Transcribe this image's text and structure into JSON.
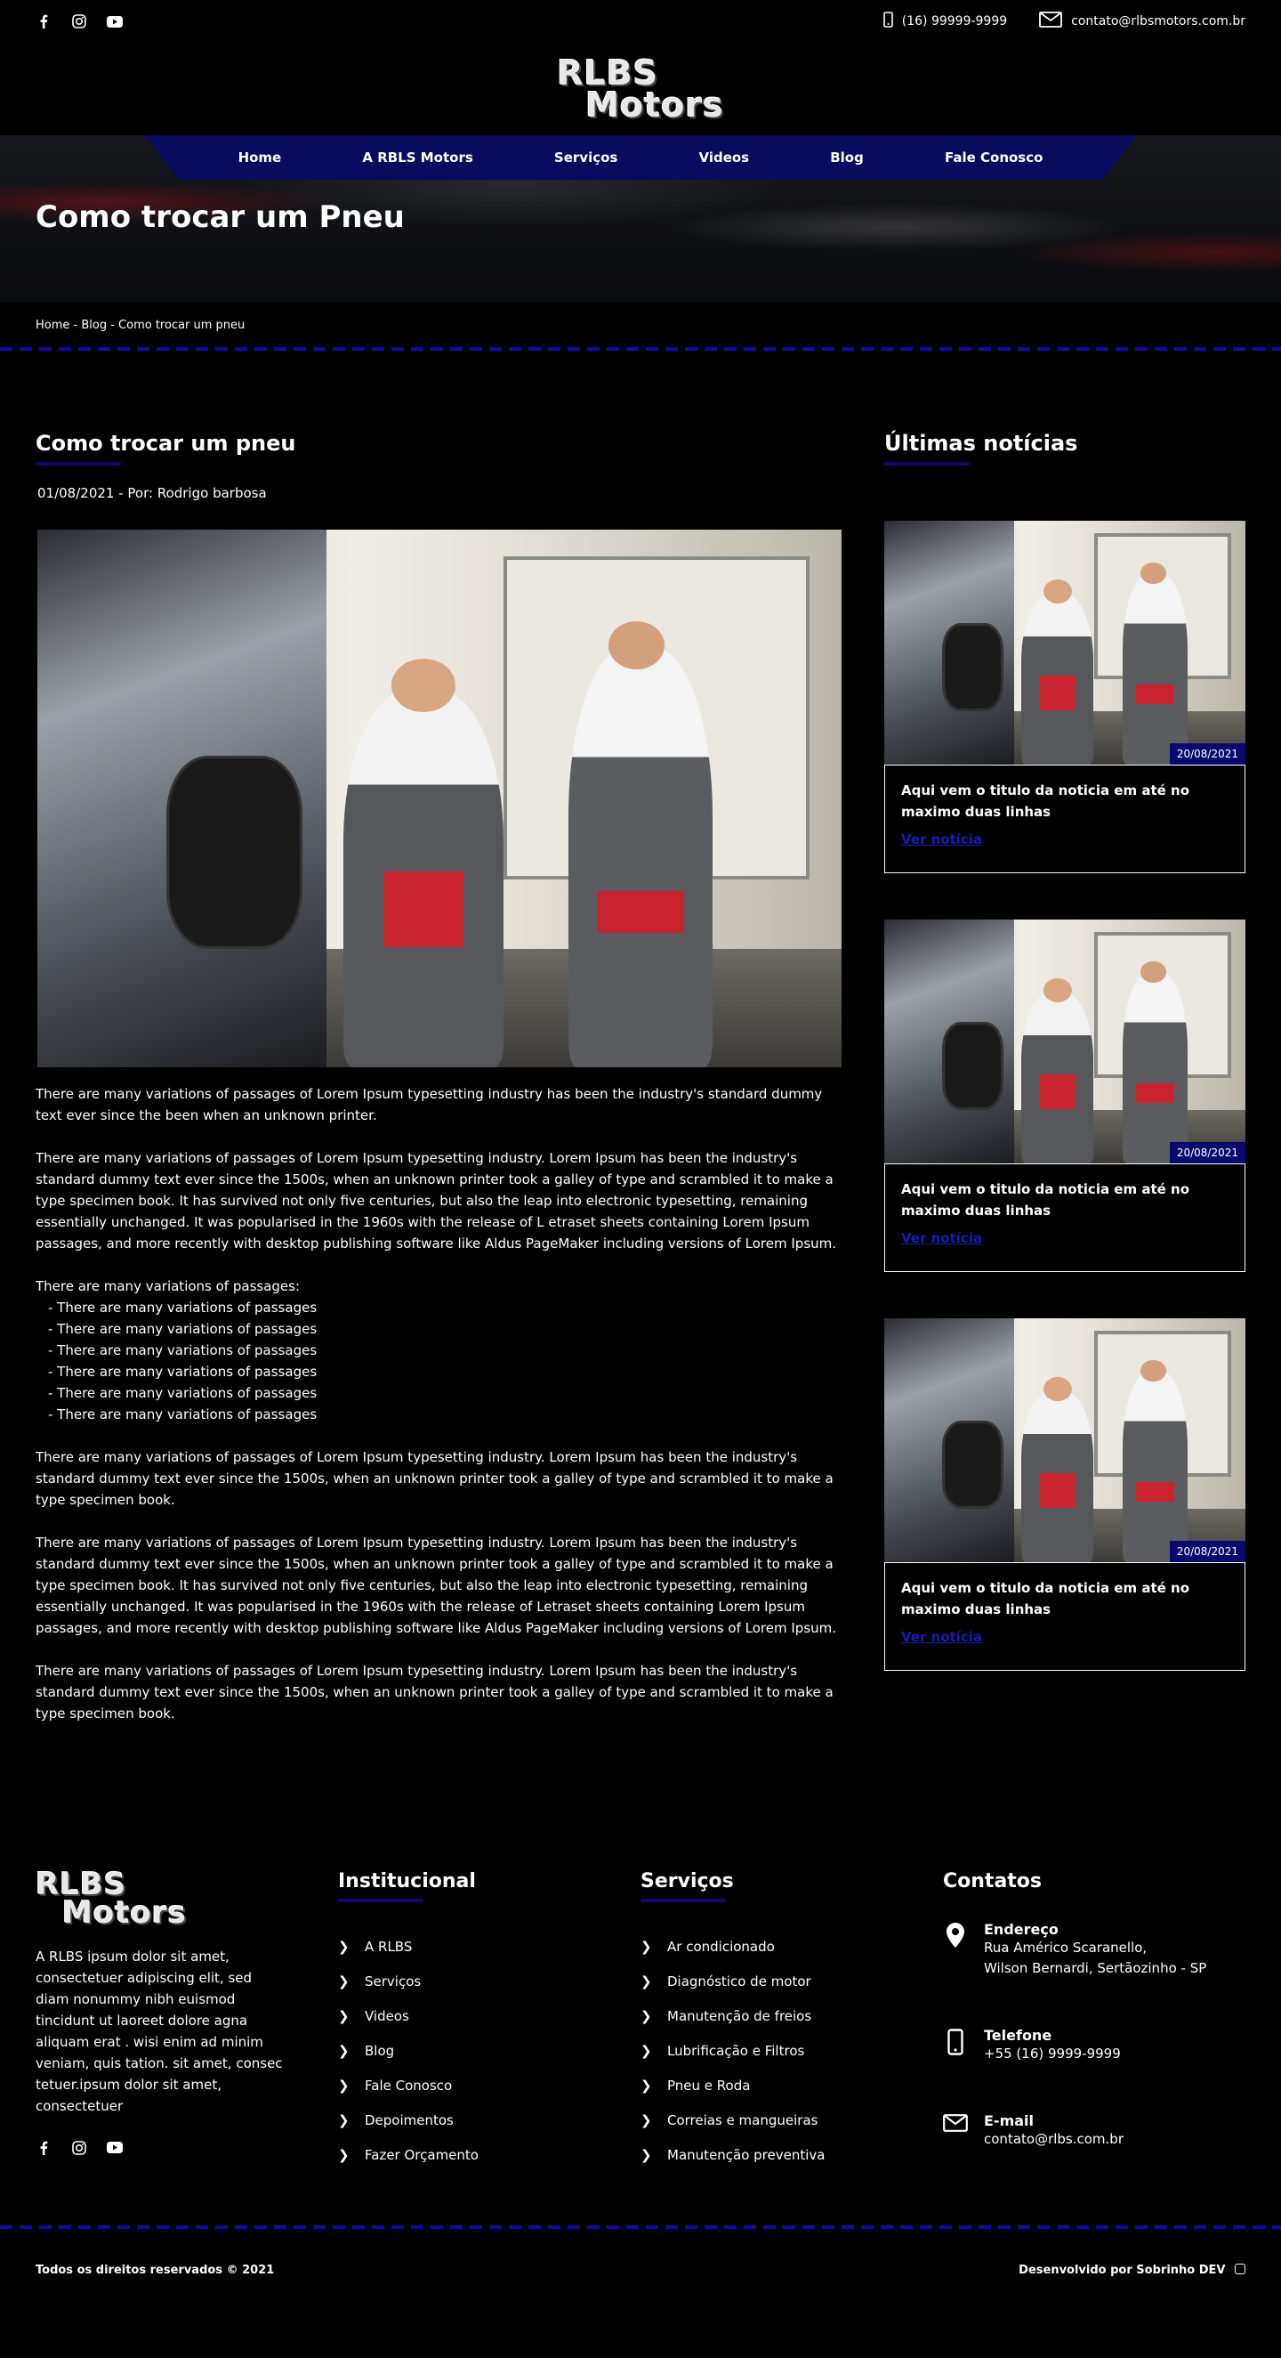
{
  "header": {
    "phone": "(16) 99999-9999",
    "email": "contato@rlbsmotors.com.br",
    "logo_line1": "RLBS",
    "logo_line2": "Motors",
    "social_icons": [
      "facebook-icon",
      "instagram-icon",
      "youtube-icon"
    ]
  },
  "nav": {
    "items": [
      "Home",
      "A  RBLS  Motors",
      "Serviços",
      "Videos",
      "Blog",
      "Fale  Conosco"
    ]
  },
  "hero": {
    "title": "Como trocar um Pneu"
  },
  "breadcrumb": {
    "text": "Home - Blog - Como trocar um pneu"
  },
  "article": {
    "title": "Como trocar um pneu",
    "meta": "01/08/2021 - Por: Rodrigo barbosa",
    "p1": "There are many variations of passages of Lorem Ipsum typesetting industry has been the industry's standard  dummy text ever since the been when an unknown printer.",
    "p2": "There are many variations of passages of Lorem Ipsum typesetting industry. Lorem Ipsum has been the industry's standard dummy text ever since the 1500s, when an unknown printer took a galley of type and scrambled it to make a type specimen book. It has survived not only five centuries, but also the leap into electronic typesetting, remaining essentially unchanged. It was popularised in the 1960s with the release  of L etraset sheets containing Lorem Ipsum passages, and more recently with desktop publishing software like Aldus PageMaker including versions of Lorem Ipsum.",
    "list_intro": "There are many variations of passages:",
    "list": [
      "- There are many variations of passages",
      "- There are many variations of passages",
      "- There are many variations of passages",
      "- There are many variations of passages",
      "- There are many variations of passages",
      "- There are many variations of passages"
    ],
    "p3": "There are many variations of passages of Lorem Ipsum typesetting industry. Lorem Ipsum has been the  industry's standard dummy text ever since the 1500s, when an unknown printer took a galley of type and scrambled it to make a type specimen book.",
    "p4": "There are many variations of passages of Lorem Ipsum typesetting industry. Lorem Ipsum has been the industry's standard dummy text ever since the 1500s, when an unknown printer took a galley of type and scrambled it to make a type specimen book. It has survived not only five centuries, but also the leap into electronic typesetting, remaining essentially unchanged. It was popularised in the 1960s with the release of Letraset sheets containing Lorem Ipsum passages, and more recently with desktop publishing software like Aldus PageMaker including versions of Lorem Ipsum.",
    "p5": "There are many variations of passages of Lorem Ipsum typesetting industry. Lorem Ipsum has been the industry's standard dummy text ever since the 1500s, when an unknown printer took a galley of type and scrambled it to make a type specimen book."
  },
  "sidebar": {
    "title": "Últimas notícias",
    "news": [
      {
        "date": "20/08/2021",
        "title": "Aqui vem o titulo da noticia em até no maximo duas linhas",
        "link": "Ver notícia"
      },
      {
        "date": "20/08/2021",
        "title": "Aqui vem o titulo da noticia em até no maximo duas linhas",
        "link": "Ver notícia"
      },
      {
        "date": "20/08/2021",
        "title": "Aqui vem o titulo da noticia em até no maximo duas linhas",
        "link": "Ver notícia"
      }
    ]
  },
  "footer": {
    "about": "A RLBS ipsum dolor sit amet, consectetuer adipiscing elit, sed diam nonummy nibh euismod tincidunt ut laoreet dolore agna aliquam erat . wisi enim ad minim veniam, quis tation. sit amet, consec tetuer.ipsum dolor sit amet, consectetuer",
    "institucional_title": "Institucional",
    "institucional": [
      "A RLBS",
      "Serviços",
      "Videos",
      "Blog",
      "Fale Conosco",
      "Depoimentos",
      "Fazer Orçamento"
    ],
    "servicos_title": "Serviços",
    "servicos": [
      "Ar condicionado",
      "Diagnóstico de motor",
      "Manutenção de freios",
      "Lubrificação e Filtros",
      "Pneu e Roda",
      "Correias e mangueiras",
      "Manutenção preventiva"
    ],
    "contatos_title": "Contatos",
    "endereco_label": "Endereço",
    "endereco_line1": "Rua Américo Scaranello,",
    "endereco_line2": "Wilson Bernardi, Sertãozinho - SP",
    "telefone_label": "Telefone",
    "telefone": "+55 (16) 9999-9999",
    "email_label": "E-mail",
    "email": "contato@rlbs.com.br",
    "copyright": "Todos os direitos reservados © 2021",
    "developer": "Desenvolvido por Sobrinho DEV"
  },
  "colors": {
    "background": "#000000",
    "accent": "#0a0a6e",
    "nav": "#0a0a5e",
    "link": "#1a1ab5"
  }
}
